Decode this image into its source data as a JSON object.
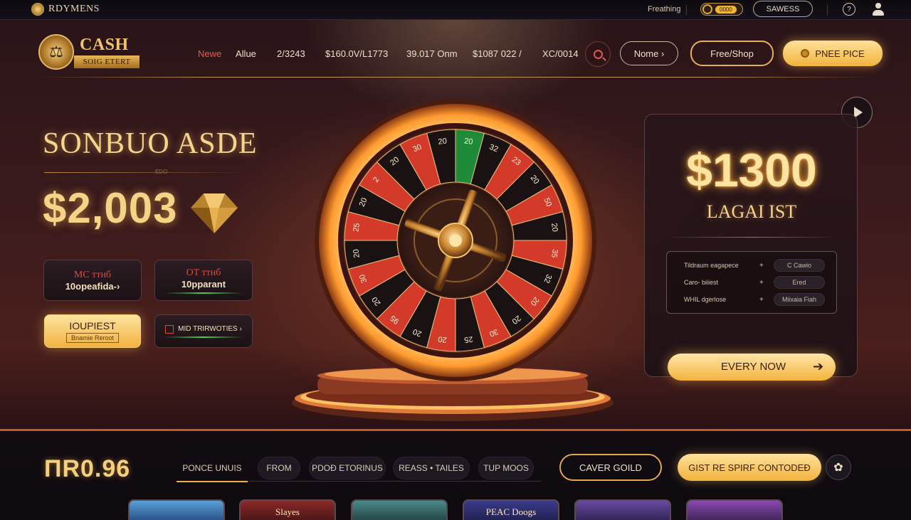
{
  "topbar": {
    "brand": "RDYMENS",
    "link": "Freathing",
    "coin_value": "0000",
    "button": "SAWESS",
    "help": "?"
  },
  "logo": {
    "line1": "CASH",
    "line2": "SOIG ETERT"
  },
  "nav": {
    "items": [
      "Newe",
      "Allue",
      "2/3243",
      "$160.0V/L1773",
      "39.017 Onm",
      "$1087 022 /",
      "XC/0014"
    ],
    "active": "Newe",
    "btn_outline": "Nome ›",
    "btn_gold_outline": "Free/Shop",
    "btn_gold": "PNEE PICE"
  },
  "hero_left": {
    "title": "SONBUO ASDE",
    "small": "EDO",
    "amount": "$2,003",
    "cards": [
      {
        "line1": "MC ттнб",
        "line2": "10opeafida-›"
      },
      {
        "line1": "OT ттнб",
        "line2": "10pparant"
      },
      {
        "line1": "IOUPIEST",
        "line2": "Bnamie Reroot"
      },
      {
        "line1": "MID TRIRWOTIES ›"
      }
    ]
  },
  "wheel": {
    "numbers": [
      "20",
      "32",
      "23",
      "20",
      "50",
      "20",
      "35",
      "32",
      "20",
      "20",
      "30",
      "25",
      "20",
      "20",
      "95",
      "20",
      "30",
      "20",
      "25",
      "20",
      "2",
      "20",
      "30",
      "20"
    ]
  },
  "promo": {
    "amount": "$1300",
    "label": "LAGAI IST",
    "rows": [
      {
        "k": "Tildraum eagapece",
        "p": "+",
        "v": "C Cawio"
      },
      {
        "k": "Caro- biiiest",
        "p": "+",
        "v": "Ered"
      },
      {
        "k": "WHIL dgerlose",
        "p": "+",
        "v": "Miixaia Fiah"
      }
    ],
    "cta": "EVERY NOW",
    "cta_arrow": "➔"
  },
  "bottom": {
    "score": "ПR0.96",
    "tabs": [
      "PONCE UNUIS",
      "FROM",
      "PDOĐ ETORINUS",
      "REASS • TAILES",
      "TUP MOOS"
    ],
    "btn_outline": "CAVER GOILD",
    "btn_gold": "GIST RE SPIRF CONTODEĐ",
    "thumbs": [
      "",
      "Slayes",
      "",
      "PEAC Doogs",
      "",
      ""
    ]
  },
  "colors": {
    "accent": "#f2b33e",
    "danger": "#e4574a",
    "bg": "#1a0e12"
  }
}
